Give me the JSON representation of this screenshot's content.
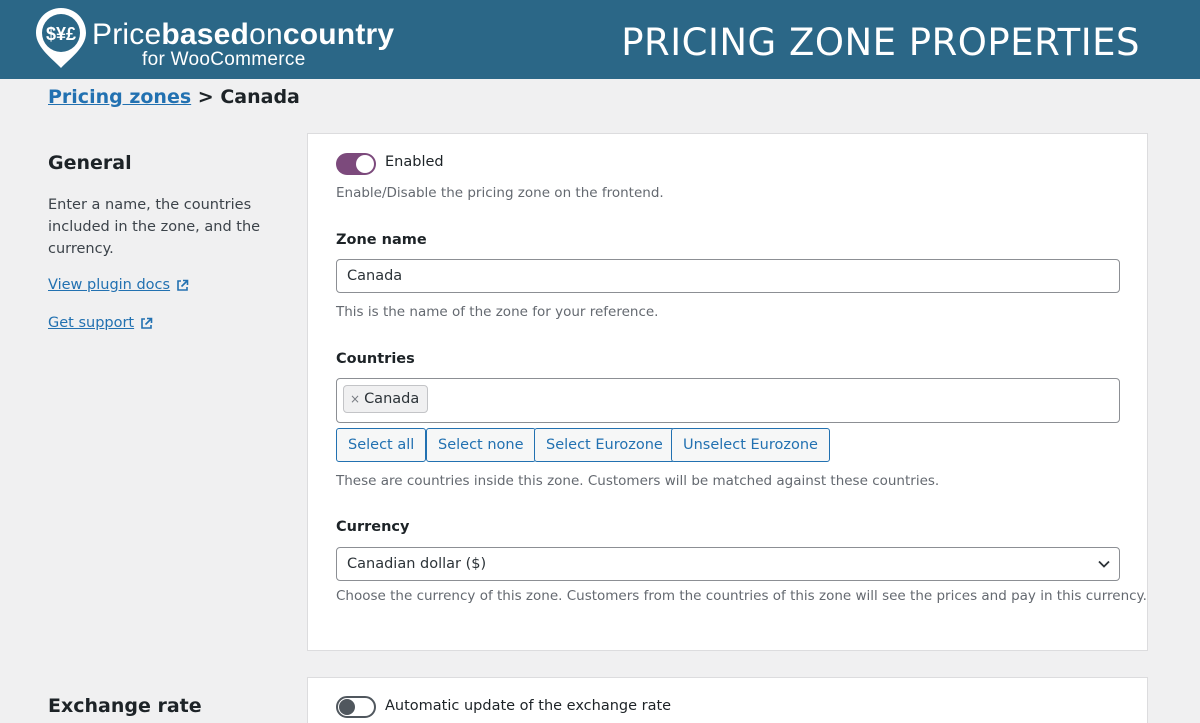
{
  "header": {
    "brand_light": "Price",
    "brand_bold": "based",
    "brand_light2": "on",
    "brand_bold2": "country",
    "brand_sub": "for WooCommerce",
    "pin_symbols": "$¥£",
    "page_title": "PRICING ZONE PROPERTIES"
  },
  "breadcrumb": {
    "link": "Pricing zones",
    "separator": ">",
    "current": "Canada"
  },
  "general": {
    "title": "General",
    "description": "Enter a name, the countries included in the zone, and the currency.",
    "docs_link": "View plugin docs",
    "support_link": "Get support"
  },
  "form": {
    "enabled": {
      "label": "Enabled",
      "state": "on",
      "help": "Enable/Disable the pricing zone on the frontend."
    },
    "zone_name": {
      "label": "Zone name",
      "value": "Canada",
      "help": "This is the name of the zone for your reference."
    },
    "countries": {
      "label": "Countries",
      "selected": [
        "Canada"
      ],
      "remove_glyph": "×",
      "buttons": [
        "Select all",
        "Select none",
        "Select Eurozone",
        "Unselect Eurozone"
      ],
      "help": "These are countries inside this zone. Customers will be matched against these countries."
    },
    "currency": {
      "label": "Currency",
      "value": "Canadian dollar ($)",
      "help": "Choose the currency of this zone. Customers from the countries of this zone will see the prices and pay in this currency."
    }
  },
  "exchange_rate": {
    "title": "Exchange rate",
    "auto_update_label": "Automatic update of the exchange rate",
    "auto_update_state": "off"
  },
  "colors": {
    "header_bg": "#2b6787",
    "link": "#2271b1",
    "toggle_on": "#7c4a7c"
  }
}
